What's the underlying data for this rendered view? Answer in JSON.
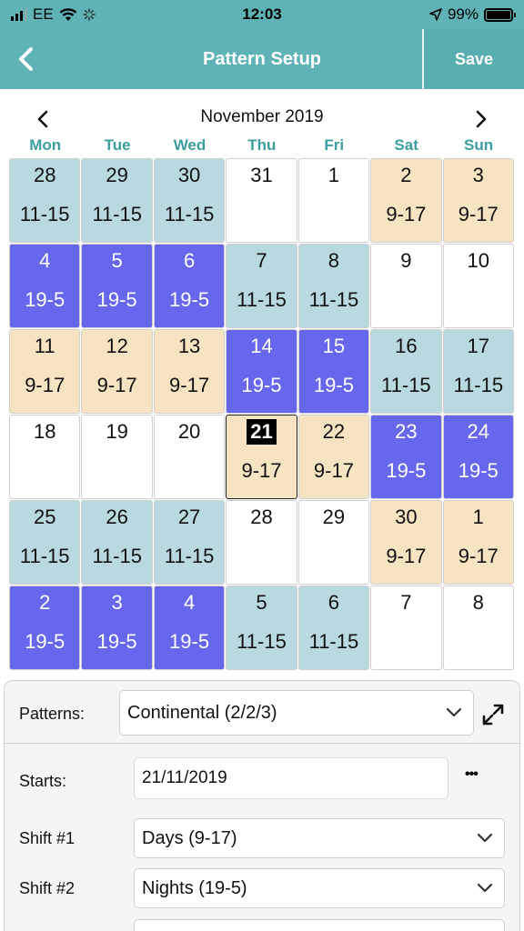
{
  "status_bar": {
    "carrier": "EE",
    "time": "12:03",
    "battery": "99%"
  },
  "nav": {
    "title": "Pattern Setup",
    "save_label": "Save"
  },
  "calendar": {
    "month": "November 2019",
    "weekdays": [
      "Mon",
      "Tue",
      "Wed",
      "Thu",
      "Fri",
      "Sat",
      "Sun"
    ],
    "today": "21",
    "weeks": [
      [
        {
          "d": "28",
          "s": "11-15",
          "t": "mid"
        },
        {
          "d": "29",
          "s": "11-15",
          "t": "mid"
        },
        {
          "d": "30",
          "s": "11-15",
          "t": "mid"
        },
        {
          "d": "31",
          "s": "",
          "t": "off"
        },
        {
          "d": "1",
          "s": "",
          "t": "off"
        },
        {
          "d": "2",
          "s": "9-17",
          "t": "day"
        },
        {
          "d": "3",
          "s": "9-17",
          "t": "day"
        }
      ],
      [
        {
          "d": "4",
          "s": "19-5",
          "t": "night"
        },
        {
          "d": "5",
          "s": "19-5",
          "t": "night"
        },
        {
          "d": "6",
          "s": "19-5",
          "t": "night"
        },
        {
          "d": "7",
          "s": "11-15",
          "t": "mid"
        },
        {
          "d": "8",
          "s": "11-15",
          "t": "mid"
        },
        {
          "d": "9",
          "s": "",
          "t": "off"
        },
        {
          "d": "10",
          "s": "",
          "t": "off"
        }
      ],
      [
        {
          "d": "11",
          "s": "9-17",
          "t": "day"
        },
        {
          "d": "12",
          "s": "9-17",
          "t": "day"
        },
        {
          "d": "13",
          "s": "9-17",
          "t": "day"
        },
        {
          "d": "14",
          "s": "19-5",
          "t": "night"
        },
        {
          "d": "15",
          "s": "19-5",
          "t": "night"
        },
        {
          "d": "16",
          "s": "11-15",
          "t": "mid"
        },
        {
          "d": "17",
          "s": "11-15",
          "t": "mid"
        }
      ],
      [
        {
          "d": "18",
          "s": "",
          "t": "off"
        },
        {
          "d": "19",
          "s": "",
          "t": "off"
        },
        {
          "d": "20",
          "s": "",
          "t": "off"
        },
        {
          "d": "21",
          "s": "9-17",
          "t": "day",
          "today": true
        },
        {
          "d": "22",
          "s": "9-17",
          "t": "day"
        },
        {
          "d": "23",
          "s": "19-5",
          "t": "night"
        },
        {
          "d": "24",
          "s": "19-5",
          "t": "night"
        }
      ],
      [
        {
          "d": "25",
          "s": "11-15",
          "t": "mid"
        },
        {
          "d": "26",
          "s": "11-15",
          "t": "mid"
        },
        {
          "d": "27",
          "s": "11-15",
          "t": "mid"
        },
        {
          "d": "28",
          "s": "",
          "t": "off"
        },
        {
          "d": "29",
          "s": "",
          "t": "off"
        },
        {
          "d": "30",
          "s": "9-17",
          "t": "day"
        },
        {
          "d": "1",
          "s": "9-17",
          "t": "day"
        }
      ],
      [
        {
          "d": "2",
          "s": "19-5",
          "t": "night"
        },
        {
          "d": "3",
          "s": "19-5",
          "t": "night"
        },
        {
          "d": "4",
          "s": "19-5",
          "t": "night"
        },
        {
          "d": "5",
          "s": "11-15",
          "t": "mid"
        },
        {
          "d": "6",
          "s": "11-15",
          "t": "mid"
        },
        {
          "d": "7",
          "s": "",
          "t": "off"
        },
        {
          "d": "8",
          "s": "",
          "t": "off"
        }
      ]
    ]
  },
  "form": {
    "patterns_label": "Patterns:",
    "patterns_value": "Continental (2/2/3)",
    "starts_label": "Starts:",
    "starts_value": "21/11/2019",
    "more_label": "•••",
    "shift1_label": "Shift #1",
    "shift1_value": "Days (9-17)",
    "shift2_label": "Shift #2",
    "shift2_value": "Nights (19-5)"
  },
  "colors": {
    "header": "#5fb3b6",
    "mid": "#b8d9e0",
    "day": "#f5e3c2",
    "night": "#6767ee",
    "weekday_text": "#3b9ea0"
  }
}
